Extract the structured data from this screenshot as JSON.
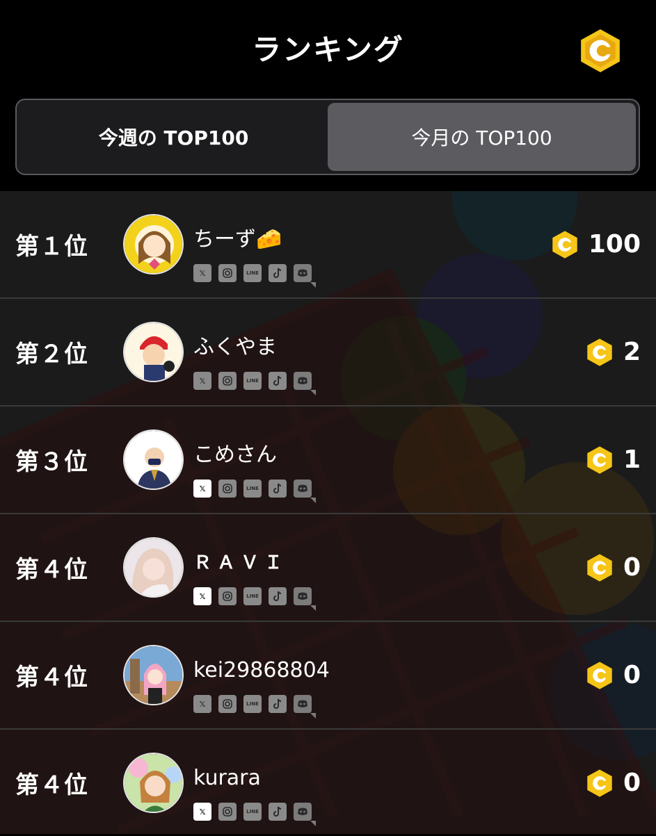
{
  "header": {
    "title": "ランキング",
    "coin_icon": "coin-c-icon"
  },
  "tabs": [
    {
      "label": "今週の TOP100",
      "active": false
    },
    {
      "label": "今月の TOP100",
      "active": true
    }
  ],
  "colors": {
    "coin": "#f5c518",
    "background": "#000000",
    "row_bg": "#1b1b1b",
    "active_tab": "#5b5b60"
  },
  "social_icons": [
    "x-icon",
    "instagram-icon",
    "line-icon",
    "tiktok-icon",
    "discord-icon"
  ],
  "rankings": [
    {
      "rank": "第１位",
      "name": "ちーず🧀",
      "score": "100",
      "x_active": false
    },
    {
      "rank": "第２位",
      "name": "ふくやま",
      "score": "2",
      "x_active": false
    },
    {
      "rank": "第３位",
      "name": "こめさん",
      "score": "1",
      "x_active": true
    },
    {
      "rank": "第４位",
      "name": "ＲＡＶＩ",
      "score": "0",
      "x_active": true
    },
    {
      "rank": "第４位",
      "name": "kei29868804",
      "score": "0",
      "x_active": false
    },
    {
      "rank": "第４位",
      "name": "kurara",
      "score": "0",
      "x_active": true
    }
  ],
  "social_labels": {
    "x": "𝕏",
    "line": "LINE"
  }
}
